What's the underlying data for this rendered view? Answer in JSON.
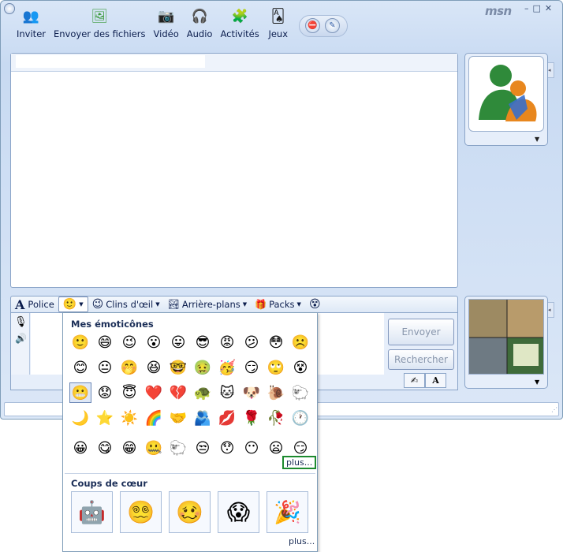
{
  "window": {
    "logo": "msn",
    "controls": [
      "–",
      "□",
      "✕"
    ]
  },
  "toolbar": {
    "items": [
      {
        "label": "Inviter",
        "icon": "people-icon",
        "glyph": "👥",
        "color": "#3d7fd6"
      },
      {
        "label": "Envoyer des fichiers",
        "icon": "folder-photo-icon",
        "glyph": "🖼",
        "color": "#3c9b3c"
      },
      {
        "label": "Vidéo",
        "icon": "webcam-icon",
        "glyph": "📷",
        "color": "#6b6b6b"
      },
      {
        "label": "Audio",
        "icon": "headset-icon",
        "glyph": "🎧",
        "color": "#2b6cb0"
      },
      {
        "label": "Activités",
        "icon": "activities-icon",
        "glyph": "🧩",
        "color": "#c2348a"
      },
      {
        "label": "Jeux",
        "icon": "cards-icon",
        "glyph": "🂡",
        "color": "#1b1b1b"
      }
    ],
    "block_icon": "⛔",
    "pen_icon": "✎"
  },
  "format_bar": {
    "font_label": "Police",
    "wink_label": "Clins d'œil",
    "backgrounds_label": "Arrière-plans",
    "packs_label": "Packs"
  },
  "buttons": {
    "send": "Envoyer",
    "search": "Rechercher"
  },
  "emoticons": {
    "title": "Mes émoticônes",
    "rows": [
      [
        "🙂",
        "😄",
        "😉",
        "😮",
        "😛",
        "😎",
        "😡",
        "😕",
        "😳",
        "☹️"
      ],
      [
        "😊",
        "😐",
        "🤭",
        "😆",
        "🤓",
        "🤢",
        "🥳",
        "😏",
        "🙄",
        "😵"
      ],
      [
        "😬",
        "😟",
        "😇",
        "❤️",
        "💔",
        "🐢",
        "🐱",
        "🐶",
        "🐌",
        "🐑"
      ],
      [
        "🌙",
        "⭐",
        "☀️",
        "🌈",
        "🤝",
        "🫂",
        "💋",
        "🌹",
        "🥀",
        "🕐"
      ],
      [
        "😀",
        "😋",
        "😁",
        "🤐",
        "🐑",
        "😒",
        "😯",
        "😶",
        "😦",
        "😏"
      ]
    ],
    "more": "plus..."
  },
  "coups": {
    "title": "Coups de cœur",
    "items": [
      "🤖",
      "😵‍💫",
      "🥴",
      "😱",
      "🎉"
    ],
    "more": "plus..."
  }
}
